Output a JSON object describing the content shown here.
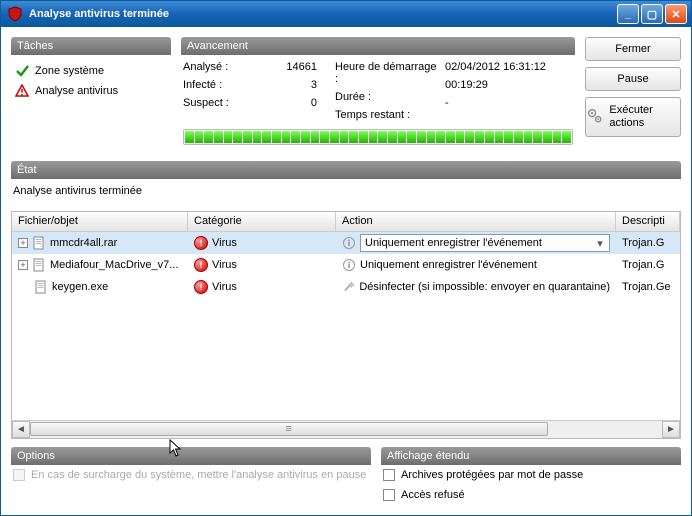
{
  "titlebar": {
    "title": "Analyse antivirus terminée"
  },
  "tasks": {
    "header": "Tâches",
    "items": [
      {
        "label": "Zone système",
        "icon": "check"
      },
      {
        "label": "Analyse antivirus",
        "icon": "warn"
      }
    ]
  },
  "progress": {
    "header": "Avancement",
    "labels": {
      "scanned": "Analysé :",
      "infected": "Infecté :",
      "suspect": "Suspect :",
      "start": "Heure de démarrage :",
      "duration": "Durée :",
      "remaining": "Temps restant :"
    },
    "values": {
      "scanned": "14661",
      "infected": "3",
      "suspect": "0",
      "start": "02/04/2012 16:31:12",
      "duration": "00:19:29",
      "remaining": "-"
    }
  },
  "buttons": {
    "close": "Fermer",
    "pause": "Pause",
    "exec": "Exécuter actions"
  },
  "state": {
    "header": "État",
    "text": "Analyse antivirus terminée"
  },
  "grid": {
    "headers": {
      "file": "Fichier/objet",
      "category": "Catégorie",
      "action": "Action",
      "description": "Descripti"
    },
    "rows": [
      {
        "expandable": true,
        "file": "mmcdr4all.rar",
        "category": "Virus",
        "action": "Uniquement enregistrer l'événement",
        "action_select": true,
        "description": "Trojan.G",
        "selected": true,
        "act_icon": "info"
      },
      {
        "expandable": true,
        "file": "Mediafour_MacDrive_v7...",
        "category": "Virus",
        "action": "Uniquement enregistrer l'événement",
        "action_select": false,
        "description": "Trojan.G",
        "selected": false,
        "act_icon": "info"
      },
      {
        "expandable": false,
        "file": "keygen.exe",
        "category": "Virus",
        "action": "Désinfecter (si impossible: envoyer en quarantaine)",
        "action_select": false,
        "description": "Trojan.Ge",
        "selected": false,
        "act_icon": "wand"
      }
    ]
  },
  "options": {
    "header": "Options",
    "pause_overload": "En cas de surcharge du système, mettre l'analyse antivirus en pause"
  },
  "extended": {
    "header": "Affichage étendu",
    "protected_archives": "Archives protégées par mot de passe",
    "access_denied": "Accès refusé"
  }
}
